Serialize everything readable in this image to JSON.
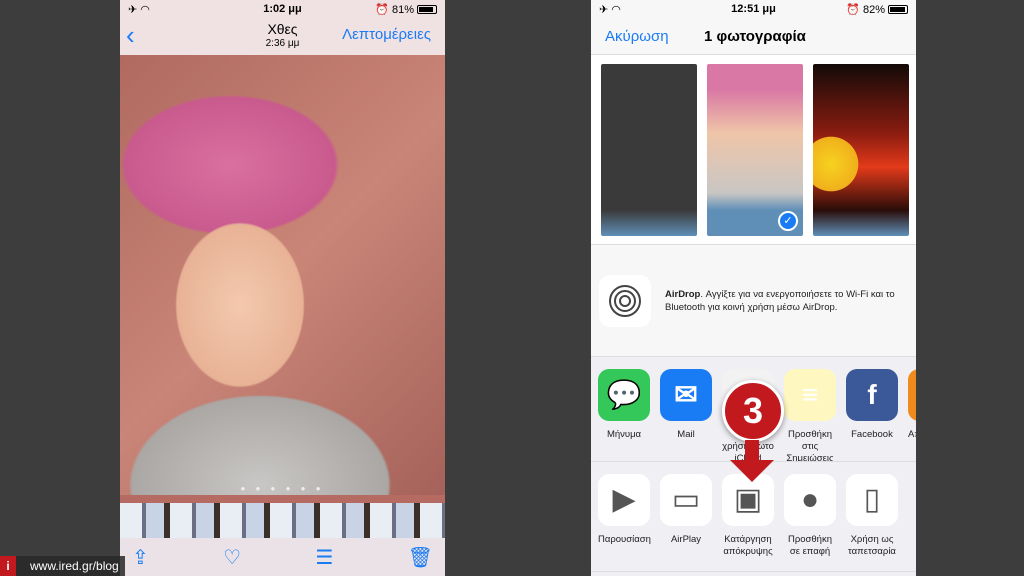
{
  "left": {
    "status": {
      "time": "1:02 μμ",
      "battery": "81%",
      "battery_level": 81
    },
    "nav": {
      "title": "Χθες",
      "subtitle": "2:36 μμ",
      "details": "Λεπτομέρειες"
    },
    "page_dots": "● ● ● ● ● ●"
  },
  "right": {
    "status": {
      "time": "12:51 μμ",
      "battery": "82%",
      "battery_level": 82
    },
    "nav": {
      "cancel": "Ακύρωση",
      "title": "1 φωτογραφία"
    },
    "airdrop": {
      "title": "AirDrop",
      "text": ". Αγγίξτε για να ενεργοποιήσετε το Wi‑Fi και το Bluetooth για κοινή χρήση μέσω AirDrop."
    },
    "apps": [
      {
        "label": "Μήνυμα",
        "color": "#34c759"
      },
      {
        "label": "Mail",
        "color": "#1a7cf5"
      },
      {
        "label": "Κοινή χρήση φωτο iCloud",
        "color": "#f2f2f2"
      },
      {
        "label": "Προσθήκη στις Σημειώσεις",
        "color": "#fff7c0"
      },
      {
        "label": "Facebook",
        "color": "#3b5998"
      },
      {
        "label": "Αποθήκευση PDF",
        "color": "#f08a1c"
      }
    ],
    "actions": [
      {
        "label": "Παρουσίαση",
        "icon": "play-icon"
      },
      {
        "label": "AirPlay",
        "icon": "airplay-icon"
      },
      {
        "label": "Κατάργηση απόκρυψης",
        "icon": "unhide-icon"
      },
      {
        "label": "Προσθήκη σε επαφή",
        "icon": "contact-icon"
      },
      {
        "label": "Χρήση ως ταπετσαρία",
        "icon": "phone-icon"
      }
    ]
  },
  "annotation": {
    "step": "3",
    "color": "#c2191f"
  },
  "watermark": {
    "logo": "i",
    "text": "www.ired.gr/blog"
  }
}
